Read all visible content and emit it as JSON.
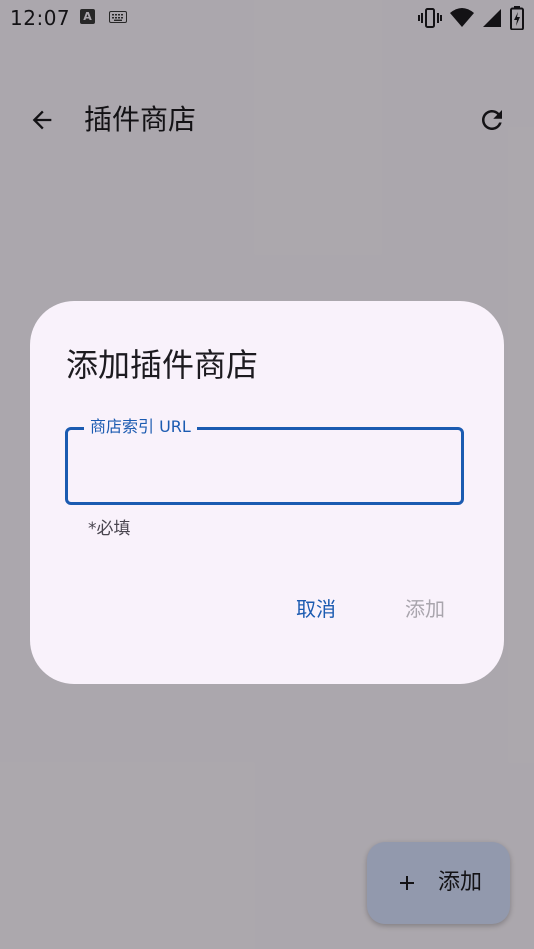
{
  "status_bar": {
    "time": "12:07",
    "left_icons": [
      "font-a-icon",
      "keyboard-icon"
    ],
    "right_icons": [
      "vibrate-icon",
      "wifi-icon",
      "signal-icon",
      "battery-charging-icon"
    ]
  },
  "app_bar": {
    "title": "插件商店",
    "back_icon": "arrow-back-icon",
    "refresh_icon": "refresh-icon"
  },
  "fab": {
    "label": "添加",
    "icon": "plus-icon"
  },
  "dialog": {
    "title": "添加插件商店",
    "field_label": "商店索引 URL",
    "field_value": "",
    "helper_text": "*必填",
    "cancel_label": "取消",
    "add_label": "添加"
  },
  "colors": {
    "primary": "#1b5bb1",
    "surface": "#fdf7ff",
    "dialog_surface": "#f9f2fb",
    "fab_container": "#d8e2ff",
    "disabled_text": "#a9a5ad"
  }
}
